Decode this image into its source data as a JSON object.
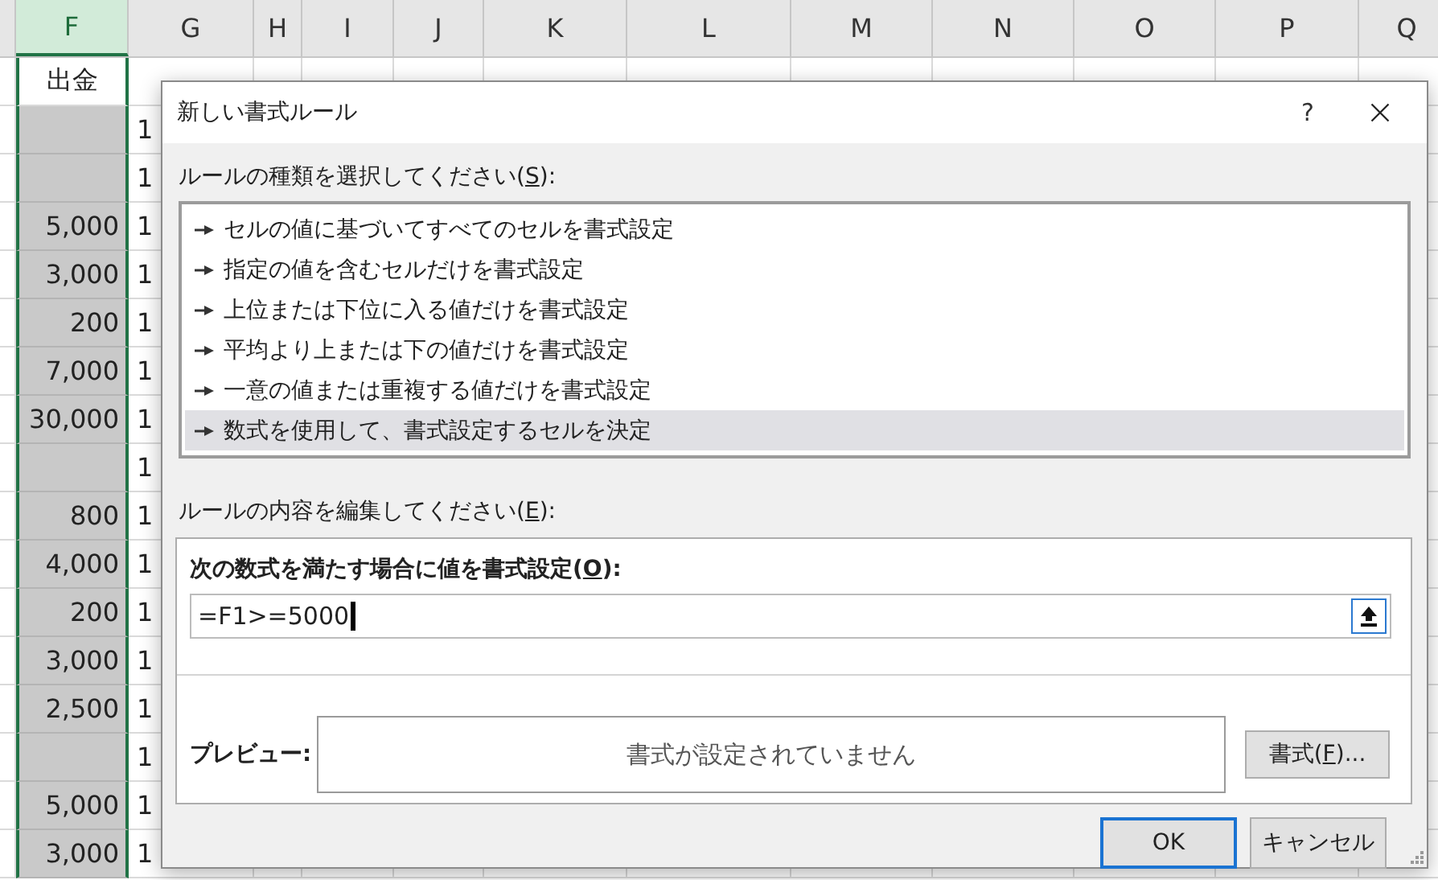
{
  "spreadsheet": {
    "columns": [
      {
        "label": "F",
        "selected": true
      },
      {
        "label": "G",
        "selected": false
      },
      {
        "label": "H",
        "selected": false
      },
      {
        "label": "I",
        "selected": false
      },
      {
        "label": "J",
        "selected": false
      },
      {
        "label": "K",
        "selected": false
      },
      {
        "label": "L",
        "selected": false
      },
      {
        "label": "M",
        "selected": false
      },
      {
        "label": "N",
        "selected": false
      },
      {
        "label": "O",
        "selected": false
      },
      {
        "label": "P",
        "selected": false
      },
      {
        "label": "Q",
        "selected": false
      }
    ],
    "rows": [
      {
        "active": true,
        "cells": [
          "出金"
        ]
      },
      {
        "active": false,
        "cells": [
          null,
          "1"
        ]
      },
      {
        "active": false,
        "cells": [
          null,
          "1"
        ]
      },
      {
        "active": false,
        "cells": [
          "5,000",
          "1"
        ]
      },
      {
        "active": false,
        "cells": [
          "3,000",
          "1"
        ]
      },
      {
        "active": false,
        "cells": [
          "200",
          "1"
        ]
      },
      {
        "active": false,
        "cells": [
          "7,000",
          "1"
        ]
      },
      {
        "active": false,
        "cells": [
          "30,000",
          "1"
        ]
      },
      {
        "active": false,
        "cells": [
          null,
          "1"
        ]
      },
      {
        "active": false,
        "cells": [
          "800",
          "1"
        ]
      },
      {
        "active": false,
        "cells": [
          "4,000",
          "1"
        ]
      },
      {
        "active": false,
        "cells": [
          "200",
          "1"
        ]
      },
      {
        "active": false,
        "cells": [
          "3,000",
          "1"
        ]
      },
      {
        "active": false,
        "cells": [
          "2,500",
          "1"
        ]
      },
      {
        "active": false,
        "cells": [
          null,
          "1"
        ]
      },
      {
        "active": false,
        "cells": [
          "5,000",
          "1"
        ]
      },
      {
        "active": false,
        "cells": [
          "3,000",
          "1"
        ]
      }
    ]
  },
  "dialog": {
    "title": "新しい書式ルール",
    "help": "?",
    "rule_type_label": {
      "text": "ルールの種類を選択してください(",
      "key": "S",
      "suffix": "):"
    },
    "rule_types": [
      {
        "label": "セルの値に基づいてすべてのセルを書式設定",
        "selected": false
      },
      {
        "label": "指定の値を含むセルだけを書式設定",
        "selected": false
      },
      {
        "label": "上位または下位に入る値だけを書式設定",
        "selected": false
      },
      {
        "label": "平均より上または下の値だけを書式設定",
        "selected": false
      },
      {
        "label": "一意の値または重複する値だけを書式設定",
        "selected": false
      },
      {
        "label": "数式を使用して、書式設定するセルを決定",
        "selected": true
      }
    ],
    "edit_label": {
      "text": "ルールの内容を編集してください(",
      "key": "E",
      "suffix": "):"
    },
    "formula_label": {
      "text": "次の数式を満たす場合に値を書式設定(",
      "key": "O",
      "suffix": "):"
    },
    "formula": "=F1>=5000",
    "preview_label": "プレビュー:",
    "preview_text": "書式が設定されていません",
    "format_button": {
      "text": "書式(",
      "key": "F",
      "suffix": ")..."
    },
    "ok": "OK",
    "cancel": "キャンセル"
  }
}
